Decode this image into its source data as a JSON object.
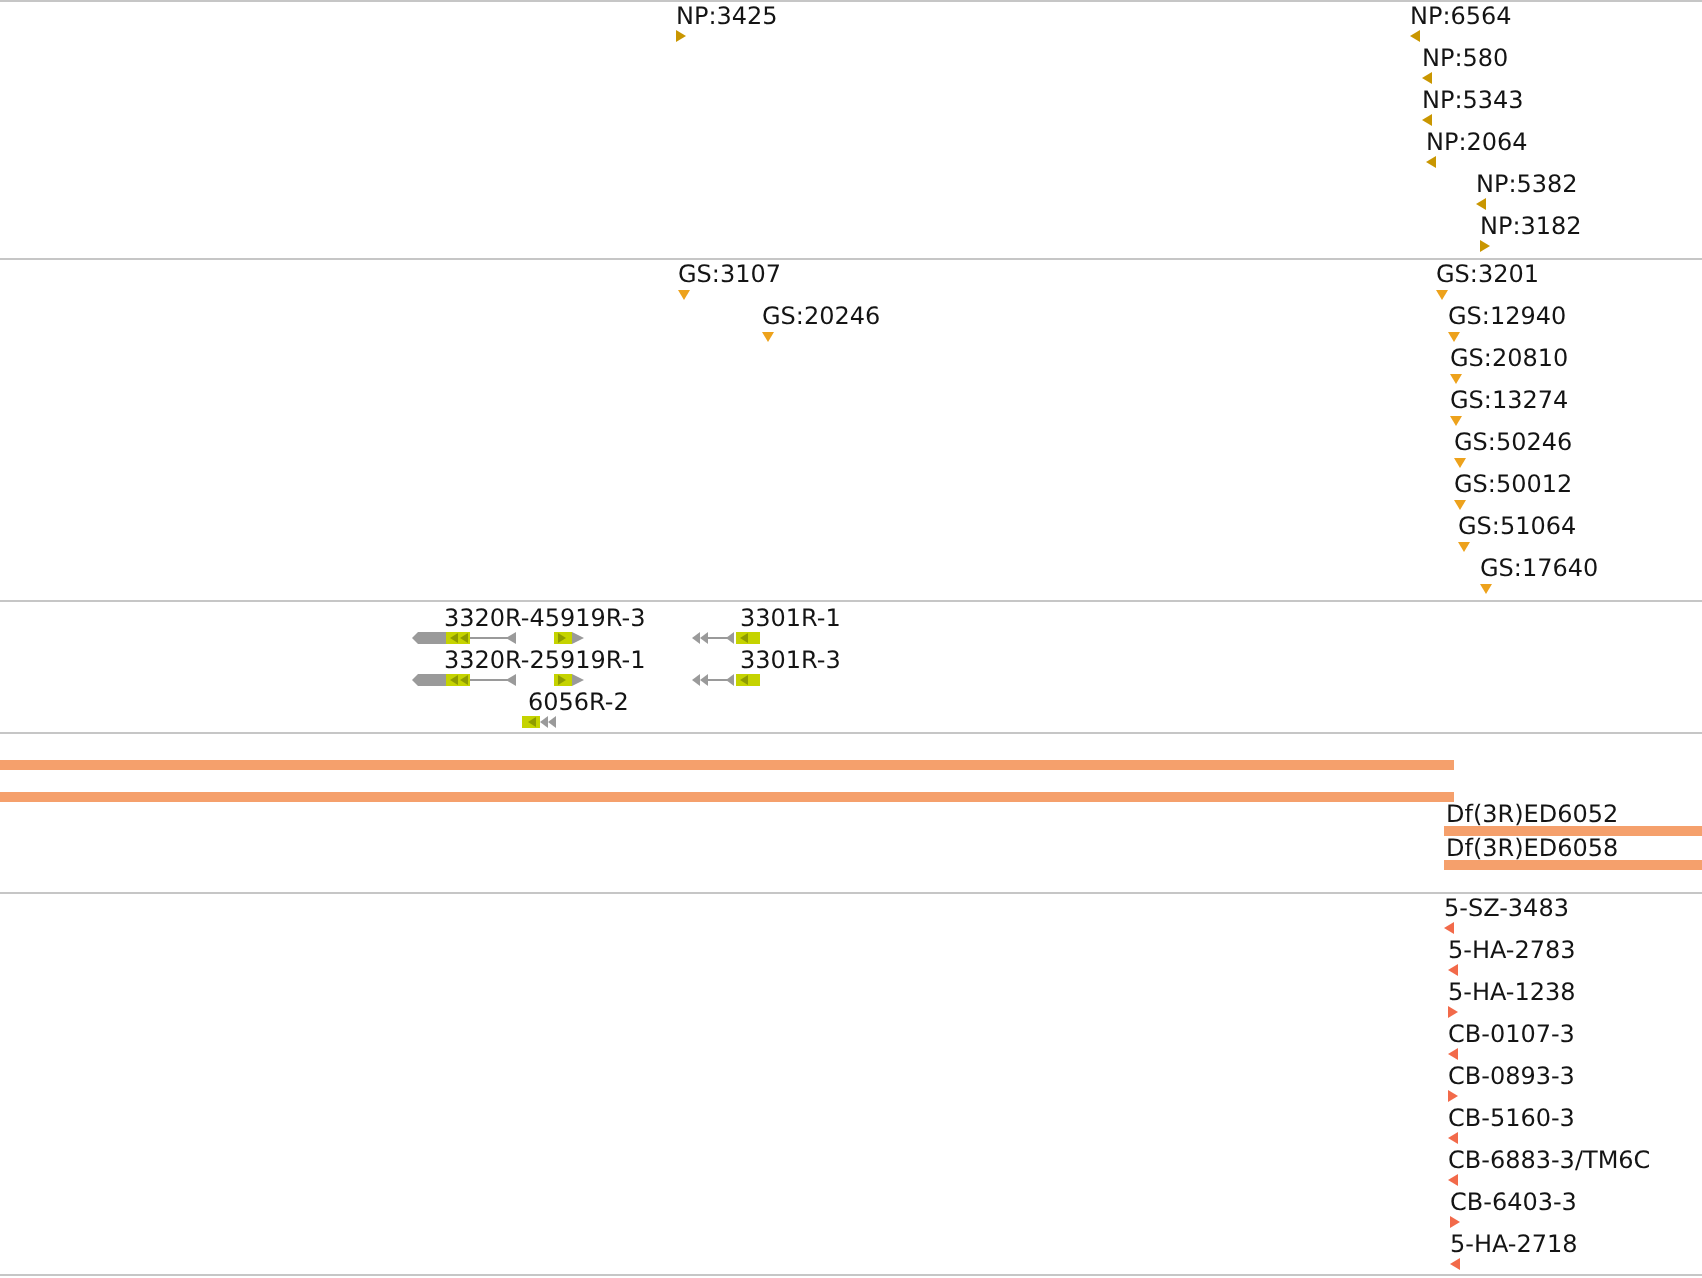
{
  "tracks": [
    {
      "kind": "markers",
      "color": "#c99600",
      "features": [
        {
          "label": "NP:3425",
          "kind": "forward"
        },
        {
          "label": "NP:6564",
          "kind": "reverse"
        },
        {
          "label": "NP:580",
          "kind": "reverse"
        },
        {
          "label": "NP:5343",
          "kind": "reverse"
        },
        {
          "label": "NP:2064",
          "kind": "reverse"
        },
        {
          "label": "NP:5382",
          "kind": "reverse"
        },
        {
          "label": "NP:3182",
          "kind": "forward"
        }
      ]
    },
    {
      "kind": "markers",
      "color": "#eda21c",
      "features": [
        {
          "label": "GS:3107",
          "kind": "unstranded"
        },
        {
          "label": "GS:20246",
          "kind": "unstranded"
        },
        {
          "label": "GS:3201",
          "kind": "unstranded"
        },
        {
          "label": "GS:12940",
          "kind": "unstranded"
        },
        {
          "label": "GS:20810",
          "kind": "unstranded"
        },
        {
          "label": "GS:13274",
          "kind": "unstranded"
        },
        {
          "label": "GS:50246",
          "kind": "unstranded"
        },
        {
          "label": "GS:50012",
          "kind": "unstranded"
        },
        {
          "label": "GS:51064",
          "kind": "unstranded"
        },
        {
          "label": "GS:17640",
          "kind": "unstranded"
        }
      ]
    },
    {
      "kind": "transcripts",
      "features": [
        {
          "label": "3320R-45919R-3"
        },
        {
          "label": "3301R-1"
        },
        {
          "label": "3320R-25919R-1"
        },
        {
          "label": "3301R-3"
        },
        {
          "label": "6056R-2"
        }
      ]
    },
    {
      "kind": "bars",
      "color": "#f5a06c",
      "features": [
        {
          "kind": "unlabeled"
        },
        {
          "kind": "unlabeled"
        },
        {
          "kind": "labeled",
          "label": "Df(3R)ED6052"
        },
        {
          "kind": "labeled",
          "label": "Df(3R)ED6058"
        }
      ]
    },
    {
      "kind": "markers",
      "color": "#f26a4a",
      "features": [
        {
          "label": "5-SZ-3483",
          "kind": "reverse"
        },
        {
          "label": "5-HA-2783",
          "kind": "reverse"
        },
        {
          "label": "5-HA-1238",
          "kind": "forward"
        },
        {
          "label": "CB-0107-3",
          "kind": "reverse"
        },
        {
          "label": "CB-0893-3",
          "kind": "forward"
        },
        {
          "label": "CB-5160-3",
          "kind": "reverse"
        },
        {
          "label": "CB-6883-3/TM6C",
          "kind": "reverse"
        },
        {
          "label": "CB-6403-3",
          "kind": "forward"
        },
        {
          "label": "5-HA-2718",
          "kind": "reverse"
        }
      ]
    }
  ]
}
